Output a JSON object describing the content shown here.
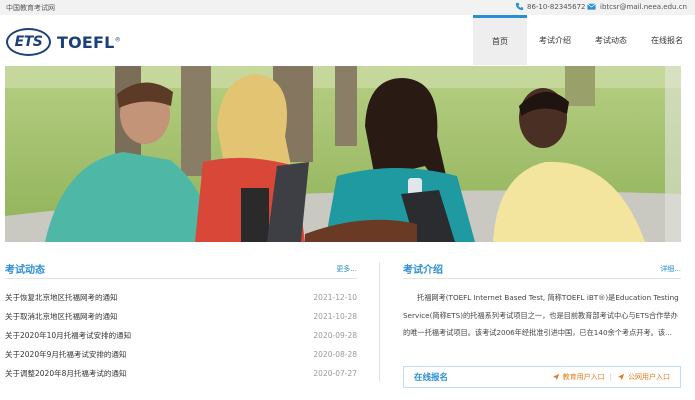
{
  "topbar": {
    "site_name": "中国教育考试网",
    "phone": "86-10-82345672",
    "email": "ibtcsr@mail.neea.edu.cn"
  },
  "header": {
    "logo_ets": "ETS",
    "logo_toefl": "TOEFL",
    "logo_mark": "®"
  },
  "nav": {
    "items": [
      {
        "label": "首页"
      },
      {
        "label": "考试介绍"
      },
      {
        "label": "考试动态"
      },
      {
        "label": "在线报名"
      }
    ]
  },
  "news": {
    "title": "考试动态",
    "more": "更多...",
    "items": [
      {
        "text": "关于恢复北京地区托福网考的通知",
        "date": "2021-12-10"
      },
      {
        "text": "关于取消北京地区托福网考的通知",
        "date": "2021-10-28"
      },
      {
        "text": "关于2020年10月托福考试安排的通知",
        "date": "2020-09-28"
      },
      {
        "text": "关于2020年9月托福考试安排的通知",
        "date": "2020-08-28"
      },
      {
        "text": "关于调整2020年8月托福考试的通知",
        "date": "2020-07-27"
      }
    ]
  },
  "intro": {
    "title": "考试介绍",
    "more": "详细...",
    "text": "托福网考(TOEFL Internet Based Test, 简称TOEFL iBT®)是Education Testing Service(简称ETS)的托福系列考试项目之一，也是目前教育部考试中心与ETS合作举办的唯一托福考试项目。该考试2006年经批准引进中国，已在140余个考点开考。该..."
  },
  "register": {
    "title": "在线报名",
    "edu_link": "教育用户入口",
    "separator": "|",
    "public_link": "公网用户入口"
  },
  "colors": {
    "accent": "#2a8fd4",
    "brand_navy": "#1d3f7a",
    "link_orange": "#e07a1f"
  }
}
